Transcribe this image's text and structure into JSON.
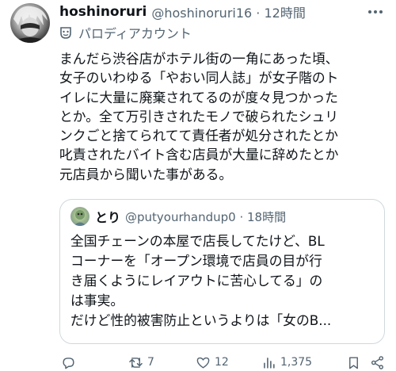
{
  "post": {
    "display_name": "hoshinoruri",
    "handle_meta": "@hoshinoruri16 · 12時間",
    "parody_label": "パロディアカウント",
    "lines": [
      "まんだら渋谷店がホテル街の一角にあった頃、",
      "女子のいわゆる「やおい同人誌」が女子階のト",
      "イレに大量に廃棄されてるのが度々見つかった",
      "とか。全て万引きされたモノで破られたシュリ",
      "ンクごと捨てられてて責任者が処分されたとか",
      "叱責されたバイト含む店員が大量に辞めたとか",
      "元店員から聞いた事がある。"
    ]
  },
  "quote": {
    "name": "とり",
    "handle_meta": "@putyourhandup0 · 18時間",
    "lines": [
      "全国チェーンの本屋で店長してたけど、BL",
      "コーナーを「オープン環境で店員の目が行",
      "き届くようにレイアウトに苦心してる」の",
      "は事実。",
      "だけど性的被害防止というよりは「女のB..."
    ]
  },
  "actions": {
    "reply_count": "",
    "retweet_count": "7",
    "like_count": "12",
    "views_count": "1,375"
  },
  "icons": {
    "more": "more-dots-icon",
    "parody": "parody-mask-icon",
    "reply": "reply-icon",
    "retweet": "retweet-icon",
    "like": "heart-icon",
    "views": "views-chart-icon",
    "bookmark": "bookmark-icon",
    "share": "share-icon"
  },
  "colors": {
    "text": "#0f1419",
    "secondary": "#536471",
    "border": "#cfd9de"
  }
}
